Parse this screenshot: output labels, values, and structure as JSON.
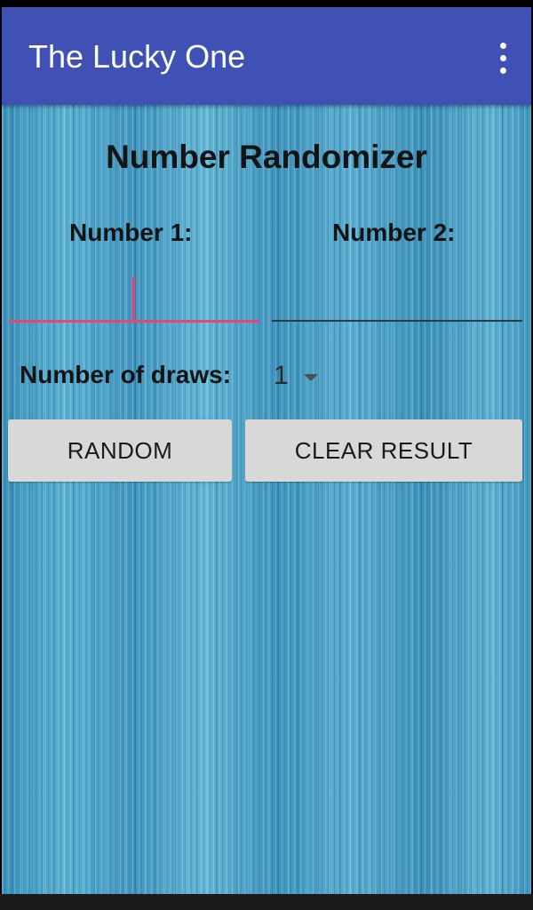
{
  "app_bar": {
    "title": "The Lucky One",
    "menu_icon": "more-vert-icon",
    "color": "#3f51b5"
  },
  "content": {
    "heading": "Number Randomizer",
    "number1": {
      "label": "Number 1:",
      "value": "",
      "placeholder": ""
    },
    "number2": {
      "label": "Number 2:",
      "value": "",
      "placeholder": ""
    },
    "draws": {
      "label": "Number of draws:",
      "selected": "1"
    },
    "buttons": {
      "random": "RANDOM",
      "clear": "CLEAR RESULT"
    }
  },
  "colors": {
    "accent": "#e8437a",
    "button_bg": "#d8d8d8",
    "background": "#4aa3c7"
  }
}
